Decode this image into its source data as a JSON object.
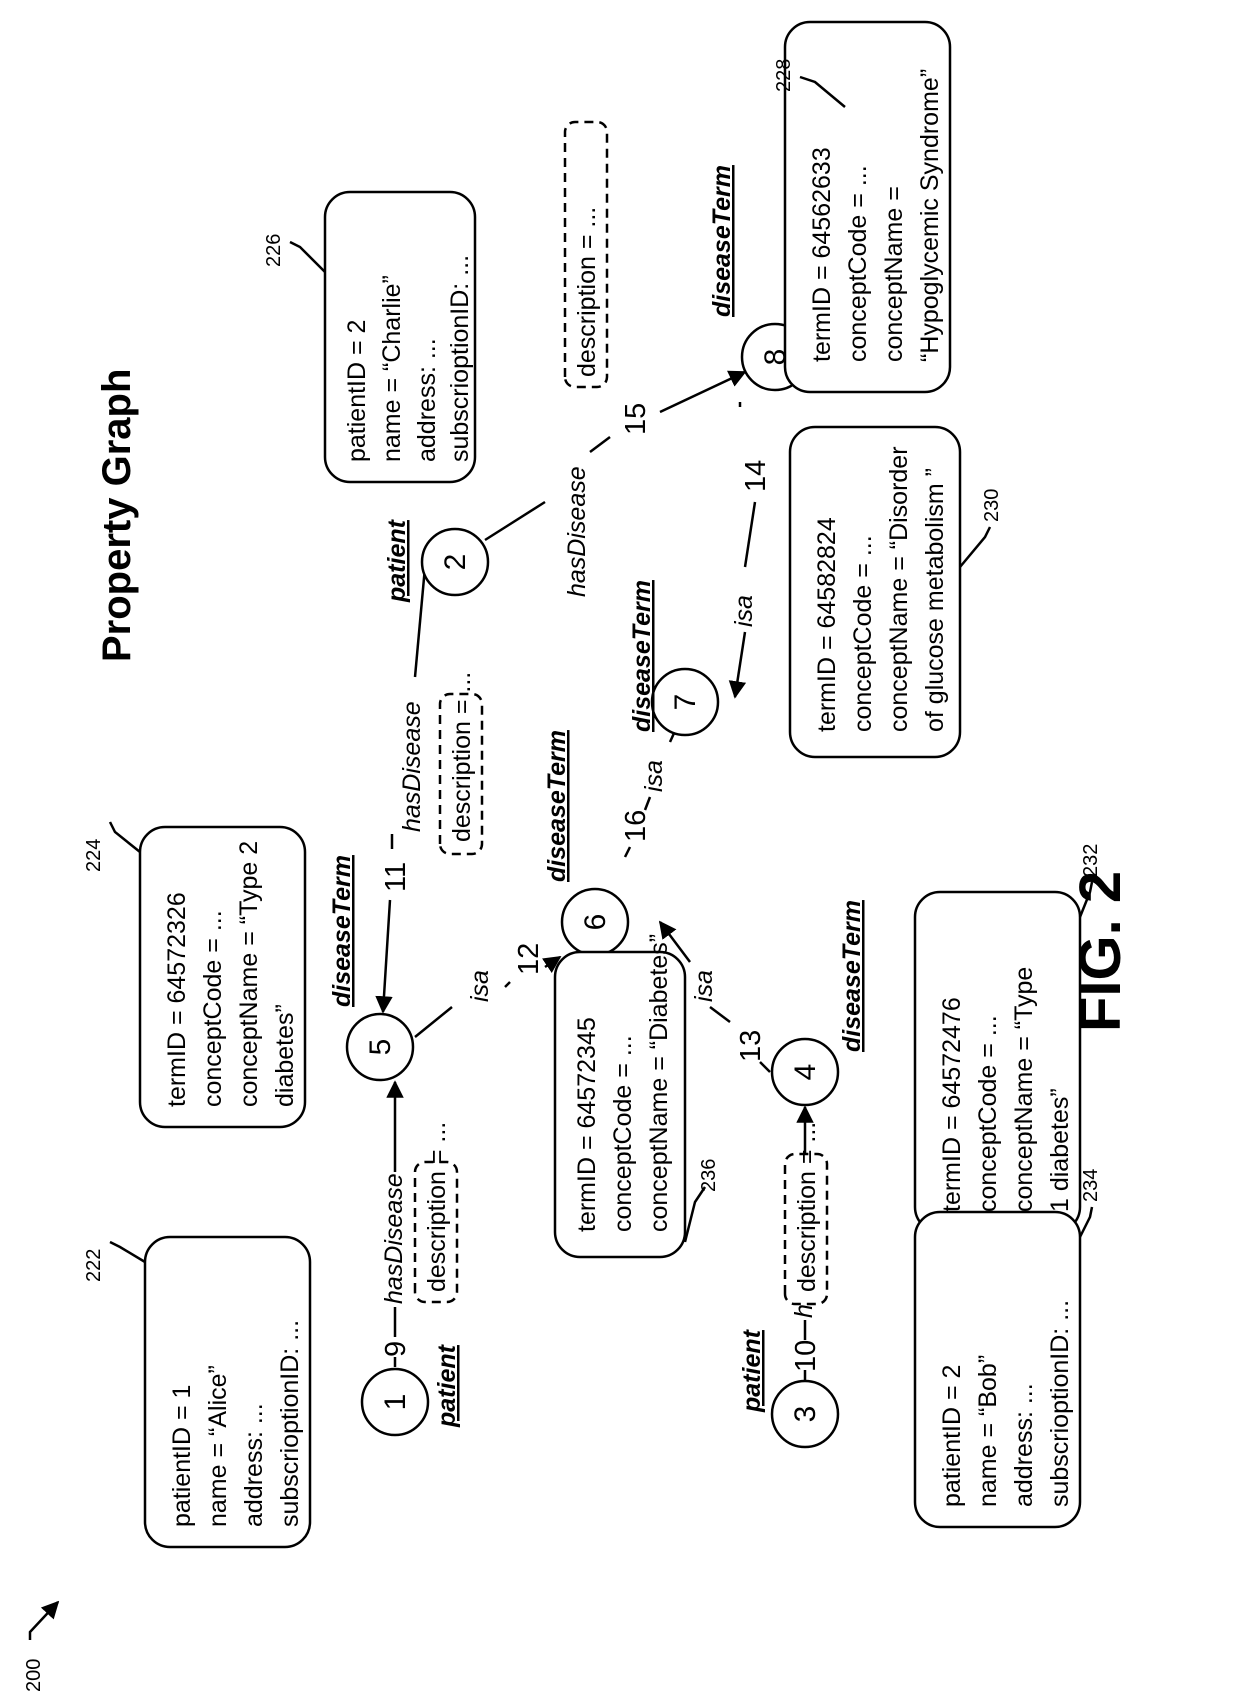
{
  "figure": {
    "title": "Property Graph",
    "caption": "FIG. 2",
    "ref_number": "200"
  },
  "nodes": [
    {
      "id": "1",
      "type": "patient"
    },
    {
      "id": "2",
      "type": "patient"
    },
    {
      "id": "3",
      "type": "patient"
    },
    {
      "id": "4",
      "type": "diseaseTerm"
    },
    {
      "id": "5",
      "type": "diseaseTerm"
    },
    {
      "id": "6",
      "type": "diseaseTerm"
    },
    {
      "id": "7",
      "type": "diseaseTerm"
    },
    {
      "id": "8",
      "type": "diseaseTerm"
    }
  ],
  "edges": [
    {
      "id": "9",
      "label": "hasDisease",
      "from": "1",
      "to": "5",
      "property": "description = ..."
    },
    {
      "id": "10",
      "label": "hasDisease",
      "from": "3",
      "to": "4",
      "property": "description = ..."
    },
    {
      "id": "11",
      "label": "hasDisease",
      "from": "2",
      "to": "5",
      "property": "description = ..."
    },
    {
      "id": "12",
      "label": "isa",
      "from": "5",
      "to": "6"
    },
    {
      "id": "13",
      "label": "isa",
      "from": "4",
      "to": "6"
    },
    {
      "id": "14",
      "label": "isa",
      "from": "8",
      "to": "7"
    },
    {
      "id": "15",
      "label": "hasDisease",
      "from": "2",
      "to": "8",
      "property": "description = ..."
    },
    {
      "id": "16",
      "label": "isa",
      "from": "6",
      "to": "7"
    }
  ],
  "property_boxes": [
    {
      "ref": "222",
      "node": "1",
      "lines": [
        "patientID =  1",
        "name = “Alice”",
        "address: ...",
        "subscrioptionID:  ..."
      ]
    },
    {
      "ref": "224",
      "node": "5",
      "lines": [
        "termID = 64572326",
        "conceptCode = ...",
        "conceptName = “Type 2",
        "diabetes”"
      ]
    },
    {
      "ref": "226",
      "node": "2",
      "lines": [
        "patientID =  2",
        "name = “Charlie”",
        "address: ...",
        "subscrioptionID:  ..."
      ]
    },
    {
      "ref": "228",
      "node": "8",
      "lines": [
        "termID = 64562633",
        "conceptCode = ...",
        "conceptName =",
        "“Hypoglycemic  Syndrome”"
      ]
    },
    {
      "ref": "230",
      "node": "7",
      "lines": [
        "termID = 64582824",
        "conceptCode = ...",
        "conceptName = “Disorder",
        "of glucose metabolism ”"
      ]
    },
    {
      "ref": "232",
      "node": "4",
      "lines": [
        "termID = 64572476",
        "conceptCode = ...",
        "conceptName = “Type",
        "1 diabetes”"
      ]
    },
    {
      "ref": "234",
      "node": "3",
      "lines": [
        "patientID =  2",
        "name = “Bob”",
        "address: ...",
        "subscrioptionID:  ..."
      ]
    },
    {
      "ref": "236",
      "node": "6",
      "lines": [
        "termID = 64572345",
        "conceptCode = ...",
        "conceptName = “Diabetes”"
      ]
    }
  ]
}
